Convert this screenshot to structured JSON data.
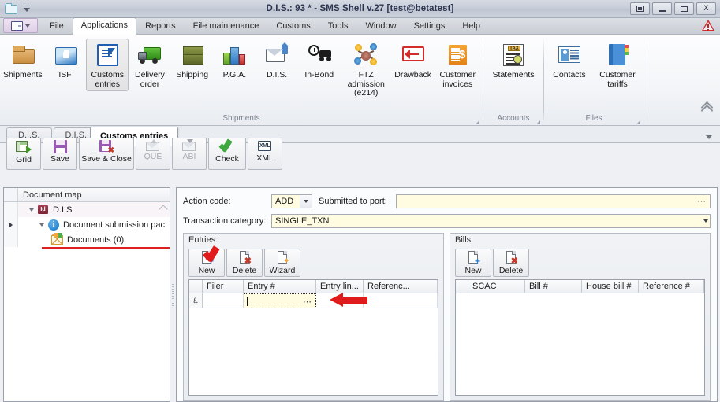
{
  "window": {
    "title": "D.I.S.: 93 * - SMS Shell v.27 [test@betatest]",
    "quick_access": {
      "folder_icon": "folder-icon",
      "dropdown_icon": "quick-access-dropdown-icon"
    },
    "controls": {
      "restore_label": "",
      "minimize_label": "",
      "maximize_label": "",
      "close_label": "X"
    }
  },
  "menubar": {
    "app_button": "application-menu-button",
    "items": [
      {
        "label": "File",
        "active": false
      },
      {
        "label": "Applications",
        "active": true
      },
      {
        "label": "Reports",
        "active": false
      },
      {
        "label": "File maintenance",
        "active": false
      },
      {
        "label": "Customs",
        "active": false
      },
      {
        "label": "Tools",
        "active": false
      },
      {
        "label": "Window",
        "active": false
      },
      {
        "label": "Settings",
        "active": false
      },
      {
        "label": "Help",
        "active": false
      }
    ],
    "warning_icon": "warning-icon"
  },
  "ribbon": {
    "groups": [
      {
        "title": "Shipments",
        "items": [
          {
            "label": "Shipments",
            "icon": "shipments-icon",
            "selected": false
          },
          {
            "label": "ISF",
            "icon": "isf-icon",
            "selected": false
          },
          {
            "label": "Customs entries",
            "icon": "customs-entries-icon",
            "selected": true
          },
          {
            "label": "Delivery order",
            "icon": "delivery-order-icon",
            "selected": false
          },
          {
            "label": "Shipping",
            "icon": "shipping-icon",
            "selected": false
          },
          {
            "label": "P.G.A.",
            "icon": "pga-icon",
            "selected": false
          },
          {
            "label": "D.I.S.",
            "icon": "dis-icon",
            "selected": false
          },
          {
            "label": "In-Bond",
            "icon": "in-bond-icon",
            "selected": false
          },
          {
            "label": "FTZ admission (e214)",
            "icon": "ftz-admission-icon",
            "selected": false
          },
          {
            "label": "Drawback",
            "icon": "drawback-icon",
            "selected": false
          },
          {
            "label": "Customer invoices",
            "icon": "customer-invoices-icon",
            "selected": false
          }
        ]
      },
      {
        "title": "Accounts",
        "items": [
          {
            "label": "Statements",
            "icon": "statements-icon",
            "selected": false
          }
        ]
      },
      {
        "title": "Files",
        "items": [
          {
            "label": "Contacts",
            "icon": "contacts-icon",
            "selected": false
          },
          {
            "label": "Customer tariffs",
            "icon": "customer-tariffs-icon",
            "selected": false
          }
        ]
      }
    ],
    "collapse_icon": "ribbon-collapse-icon"
  },
  "doc_tabs": {
    "tabs": [
      {
        "label": "D.I.S.",
        "active": false
      },
      {
        "label": "D.I.S.",
        "active": false
      }
    ],
    "current_tab": "Customs entries",
    "overflow_icon": "tabs-overflow-caret-icon"
  },
  "toolbar": {
    "buttons": [
      {
        "label": "Grid",
        "icon": "grid-icon",
        "enabled": true
      },
      {
        "label": "Save",
        "icon": "save-icon",
        "enabled": true
      },
      {
        "label": "Save & Close",
        "icon": "save-close-icon",
        "enabled": true
      },
      {
        "label": "QUE",
        "icon": "que-icon",
        "enabled": false
      },
      {
        "label": "ABI",
        "icon": "abi-icon",
        "enabled": false
      },
      {
        "label": "Check",
        "icon": "check-icon",
        "enabled": true
      },
      {
        "label": "XML",
        "icon": "xml-icon",
        "enabled": true
      }
    ]
  },
  "tree": {
    "header": "Document map",
    "nodes": [
      {
        "label": "D.I.S",
        "icon": "id-card-icon",
        "depth": 0,
        "expanded": true,
        "selected": true
      },
      {
        "label": "Document submission pac",
        "icon": "info-icon",
        "depth": 1,
        "expanded": true,
        "selected": false,
        "underlined": true
      },
      {
        "label": "Documents (0)",
        "icon": "envelope-icon",
        "depth": 2,
        "expanded": false,
        "selected": false
      }
    ]
  },
  "form": {
    "action_code_label": "Action code:",
    "action_code_value": "ADD",
    "submitted_to_port_label": "Submitted to port:",
    "submitted_to_port_value": "",
    "submitted_to_port_ellipsis": "⋯",
    "transaction_category_label": "Transaction category:",
    "transaction_category_value": "SINGLE_TXN"
  },
  "entries_pane": {
    "title": "Entries:",
    "buttons": [
      {
        "label": "New",
        "icon": "new-document-icon"
      },
      {
        "label": "Delete",
        "icon": "delete-document-icon"
      },
      {
        "label": "Wizard",
        "icon": "wizard-icon"
      }
    ],
    "columns": [
      "Filer",
      "Entry #",
      "Entry lin...",
      "Referenc..."
    ],
    "rows": [
      {
        "row_indicator": "ℓ.",
        "Filer": "",
        "Entry #": "",
        "entry_editing": true,
        "entry_ellipsis": "⋯",
        "Entry lin...": "",
        "Referenc...": ""
      }
    ]
  },
  "bills_pane": {
    "title": "Bills",
    "buttons": [
      {
        "label": "New",
        "icon": "new-document-icon"
      },
      {
        "label": "Delete",
        "icon": "delete-document-icon"
      }
    ],
    "columns": [
      "SCAC",
      "Bill #",
      "House bill #",
      "Reference #"
    ],
    "rows": []
  },
  "annotations": {
    "check_mark": "red-check-annotation",
    "arrow_to_entry_cell": "red-arrow-annotation",
    "underline_document_submission": "red-underline-annotation"
  },
  "colors": {
    "accent_red": "#e01b1b",
    "field_yellow": "#fffce1",
    "titlebar": "#c8ced9",
    "selected_tab": "#ffffff"
  }
}
